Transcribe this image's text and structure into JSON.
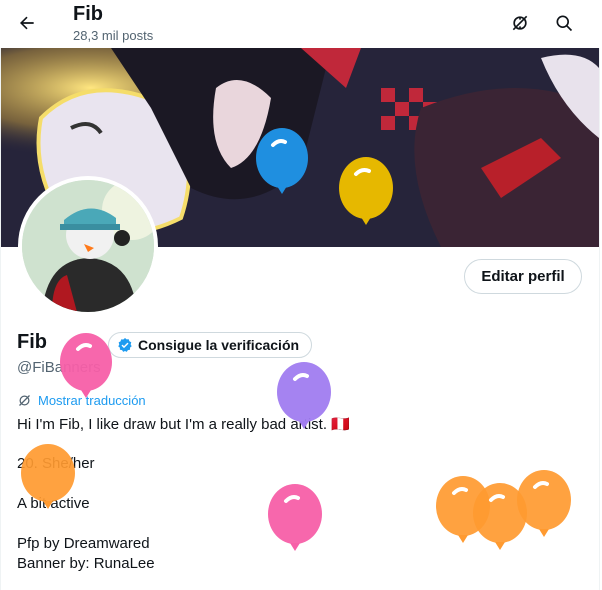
{
  "header": {
    "back_label": "Back",
    "title": "Fib",
    "subtitle": "28,3 mil posts"
  },
  "profile": {
    "name": "Fib",
    "handle": "@FiBanners",
    "verify_label": "Consigue la verificación",
    "edit_label": "Editar perfil",
    "translate_label": "Mostrar traducción",
    "bio": [
      "Hi I'm Fib, I like draw but I'm a really bad artist. 🇵🇪",
      "20. She/her",
      "A bit active",
      "Pfp by Dreamwared",
      "Banner by: RunaLee"
    ]
  },
  "icons": {
    "back": "arrow-left-icon",
    "translate": "no-translate-icon",
    "search": "search-icon",
    "verified": "verified-badge-icon"
  },
  "colors": {
    "accent": "#1d9bf0",
    "balloon_pink": "#f75fa8",
    "balloon_purple": "#a07cf0",
    "balloon_orange": "#ff9a30",
    "balloon_blue": "#1f8fe0",
    "balloon_yellow": "#e6b800"
  }
}
